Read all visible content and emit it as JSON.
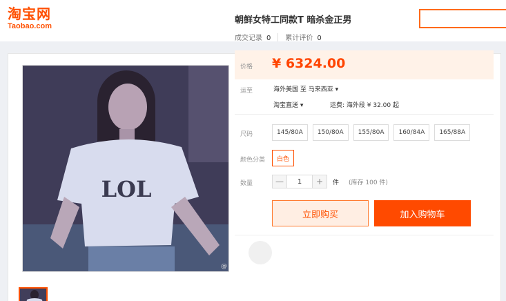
{
  "header": {
    "logo_cn": "淘宝网",
    "logo_en": "Taobao.com"
  },
  "product": {
    "title": "朝鲜女特工同款T 暗杀金正男",
    "deal_records_label": "成交记录",
    "deal_records_count": "0",
    "reviews_label": "累计评价",
    "reviews_count": "0",
    "image_shirt_text": "LOL"
  },
  "price": {
    "label": "价格",
    "value": "¥ 6324.00"
  },
  "shipping": {
    "label": "运至",
    "route": "海外美国 至  马来西亚 ▾",
    "method": "淘宝直送 ▾",
    "fee": "运费: 海外段 ¥ 32.00 起"
  },
  "size": {
    "label": "尺码",
    "options": [
      "145/80A",
      "150/80A",
      "155/80A",
      "160/84A",
      "165/88A"
    ]
  },
  "color": {
    "label": "颜色分类",
    "selected": "白色"
  },
  "quantity": {
    "label": "数量",
    "minus": "—",
    "value": "1",
    "plus": "+",
    "unit": "件",
    "stock": "(库存 100 件)"
  },
  "actions": {
    "buy_now": "立即购买",
    "add_to_cart": "加入购物车"
  },
  "colors": {
    "accent": "#ff5000",
    "price_bg": "#fff2e8",
    "cart_bg": "#ff4a00"
  }
}
